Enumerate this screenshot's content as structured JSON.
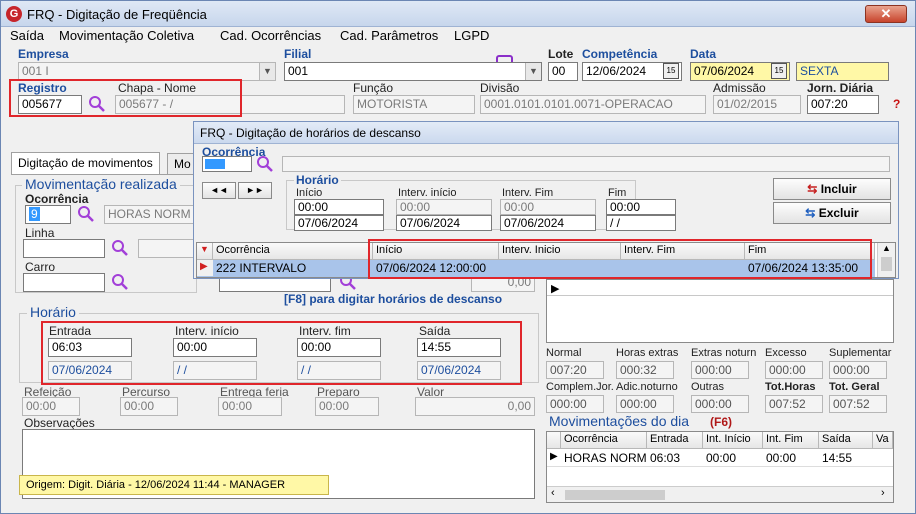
{
  "window": {
    "title": "FRQ - Digitação de Freqüência",
    "close_glyph": "✕",
    "app_icon": "G"
  },
  "menu": [
    "Saída",
    "Movimentação Coletiva",
    "Cad. Ocorrências",
    "Cad. Parâmetros",
    "LGPD"
  ],
  "header": {
    "empresa_label": "Empresa",
    "empresa_value": "001 I",
    "filial_label": "Filial",
    "filial_value": "001",
    "lote_label": "Lote",
    "lote_value": "00",
    "competencia_label": "Competência",
    "competencia_value": "12/06/2024",
    "data_label": "Data",
    "data_value": "07/06/2024",
    "weekday": "SEXTA",
    "registro_label": "Registro",
    "registro_value": "005677",
    "chapa_label": "Chapa  -  Nome",
    "chapa_value": "005677 - /",
    "funcao_label": "Função",
    "funcao_value": "MOTORISTA",
    "divisao_label": "Divisão",
    "divisao_value": "0001.0101.0101.0071-OPERACAO",
    "admissao_label": "Admissão",
    "admissao_value": "01/02/2015",
    "jornada_label": "Jorn. Diária",
    "jornada_value": "007:20",
    "help_glyph": "?"
  },
  "tabs": [
    "Digitação de movimentos",
    "Mo"
  ],
  "movimentacao": {
    "title": "Movimentação realizada",
    "ocorrencia_label": "Ocorrência",
    "ocorrencia_code": "9",
    "ocorrencia_desc": "HORAS NORM",
    "linha_label": "Linha",
    "carro_label": "Carro",
    "valor_zero": "0,00",
    "f8_hint": "[F8] para digitar horários de descanso"
  },
  "horario": {
    "title": "Horário",
    "entrada_label": "Entrada",
    "entrada_value": "06:03",
    "entrada_date": "07/06/2024",
    "int_inicio_label": "Interv. início",
    "int_inicio_value": "00:00",
    "int_inicio_date": " / /",
    "int_fim_label": "Interv. fim",
    "int_fim_value": "00:00",
    "int_fim_date": " / /",
    "saida_label": "Saída",
    "saida_value": "14:55",
    "saida_date": "07/06/2024"
  },
  "extras": {
    "refeicao_label": "Refeição",
    "refeicao_value": "00:00",
    "percurso_label": "Percurso",
    "percurso_value": "00:00",
    "entrega_label": "Entrega feria",
    "entrega_value": "00:00",
    "preparo_label": "Preparo",
    "preparo_value": "00:00",
    "valor_label": "Valor",
    "valor_value": "0,00",
    "obs_label": "Observações"
  },
  "origem": "Origem: Digit. Diária - 12/06/2024 11:44 - MANAGER",
  "dialog": {
    "title": "FRQ - Digitação de horários de descanso",
    "ocorrencia_label": "Ocorrência",
    "horario_label": "Horário",
    "inicio_label": "Início",
    "inicio_time": "00:00",
    "inicio_date": "07/06/2024",
    "int_inicio_label": "Interv. início",
    "int_inicio_time": "00:00",
    "int_inicio_date": "07/06/2024",
    "int_fim_label": "Interv. Fim",
    "int_fim_time": "00:00",
    "int_fim_date": "07/06/2024",
    "fim_label": "Fim",
    "fim_time": "00:00",
    "fim_date": " / /",
    "incluir_label": "Incluir",
    "excluir_label": "Excluir",
    "grid_headers": [
      "Ocorrência",
      "Início",
      "Interv. Inicio",
      "Interv. Fim",
      "Fim"
    ],
    "grid_row": {
      "ocorrencia": "222 INTERVALO",
      "inicio": "07/06/2024 12:00:00",
      "int_inicio": "",
      "int_fim": "",
      "fim": "07/06/2024 13:35:00"
    }
  },
  "summary": {
    "normal_label": "Normal",
    "normal_value": "007:20",
    "horas_extras_label": "Horas extras",
    "horas_extras_value": "000:32",
    "extras_noturn_label": "Extras noturn",
    "extras_noturn_value": "000:00",
    "excesso_label": "Excesso",
    "excesso_value": "000:00",
    "suplementar_label": "Suplementar",
    "suplementar_value": "000:00",
    "complem_label": "Complem.Jor.",
    "complem_value": "000:00",
    "adic_label": "Adic.noturno",
    "adic_value": "000:00",
    "outras_label": "Outras",
    "outras_value": "000:00",
    "tot_horas_label": "Tot.Horas",
    "tot_horas_value": "007:52",
    "tot_geral_label": "Tot. Geral",
    "tot_geral_value": "007:52"
  },
  "mov_dia": {
    "title": "Movimentações do dia",
    "hotkey": "(F6)",
    "headers": [
      "Ocorrência",
      "Entrada",
      "Int. Início",
      "Int. Fim",
      "Saída",
      "Va"
    ],
    "row": [
      "HORAS NORM",
      "06:03",
      "00:00",
      "00:00",
      "14:55",
      ""
    ]
  },
  "colors": {
    "accent": "#1d4e9e",
    "highlight_red": "#e0262b",
    "selected_row": "#a9c4ea",
    "yellow": "#fff8a6"
  }
}
